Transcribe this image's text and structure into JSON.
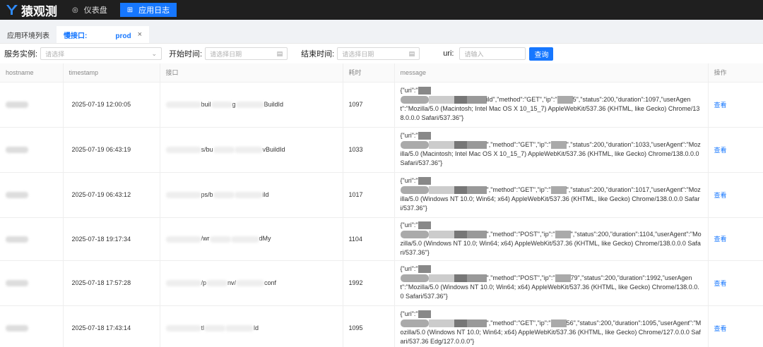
{
  "header": {
    "app_name": "猿观测",
    "nav": [
      {
        "label": "仪表盘",
        "icon": "dashboard-icon"
      },
      {
        "label": "应用日志",
        "icon": "log-grid-icon"
      }
    ]
  },
  "tabs": [
    {
      "label": "应用环境列表"
    },
    {
      "label": "慢接口:",
      "suffix": "prod"
    }
  ],
  "filters": {
    "instance_label": "服务实例:",
    "instance_placeholder": "请选择",
    "start_label": "开始时间:",
    "start_placeholder": "请选择日期",
    "end_label": "结束时间:",
    "end_placeholder": "请选择日期",
    "uri_label": "uri:",
    "uri_placeholder": "请输入",
    "search_label": "查询"
  },
  "table": {
    "columns": [
      "hostname",
      "timestamp",
      "接口",
      "耗时",
      "message",
      "操作"
    ],
    "rows": [
      {
        "timestamp": "2025-07-19 12:00:05",
        "api_parts": [
          "buil",
          "g",
          "BuildId"
        ],
        "duration": "1097",
        "msg_prefix": "{\"uri\":\"",
        "msg_mid": "ild\",\"method\":\"GET\",\"ip\":\"",
        "msg_rest": "5\",\"status\":200,\"duration\":1097,\"userAgent\":\"Mozilla/5.0 (Macintosh; Intel Mac OS X 10_15_7) AppleWebKit/537.36 (KHTML, like Gecko) Chrome/138.0.0.0 Safari/537.36\"}",
        "action": "查看"
      },
      {
        "timestamp": "2025-07-19 06:43:19",
        "api_parts": [
          "s/bu",
          "",
          "vBuildId"
        ],
        "duration": "1033",
        "msg_prefix": "{\"uri\":\"",
        "msg_mid": "\",\"method\":\"GET\",\"ip\":\"",
        "msg_rest": "\",\"status\":200,\"duration\":1033,\"userAgent\":\"Mozilla/5.0 (Macintosh; Intel Mac OS X 10_15_7) AppleWebKit/537.36 (KHTML, like Gecko) Chrome/138.0.0.0 Safari/537.36\"}",
        "action": "查看"
      },
      {
        "timestamp": "2025-07-19 06:43:12",
        "api_parts": [
          "ps/b",
          "",
          "ild"
        ],
        "duration": "1017",
        "msg_prefix": "{\"uri\":\"",
        "msg_mid": "\",\"method\":\"GET\",\"ip\":\"",
        "msg_rest": "\",\"status\":200,\"duration\":1017,\"userAgent\":\"Mozilla/5.0 (Windows NT 10.0; Win64; x64) AppleWebKit/537.36 (KHTML, like Gecko) Chrome/138.0.0.0 Safari/537.36\"}",
        "action": "查看"
      },
      {
        "timestamp": "2025-07-18 19:17:34",
        "api_parts": [
          "/wr",
          "",
          "dMy"
        ],
        "duration": "1104",
        "msg_prefix": "{\"uri\":\"",
        "msg_mid": "\",\"method\":\"POST\",\"ip\":\"",
        "msg_rest": "\",\"status\":200,\"duration\":1104,\"userAgent\":\"Mozilla/5.0 (Windows NT 10.0; Win64; x64) AppleWebKit/537.36 (KHTML, like Gecko) Chrome/138.0.0.0 Safari/537.36\"}",
        "action": "查看"
      },
      {
        "timestamp": "2025-07-18 17:57:28",
        "api_parts": [
          "/p",
          "nv/",
          "conf"
        ],
        "duration": "1992",
        "msg_prefix": "{\"uri\":\"",
        "msg_mid": "\",\"method\":\"POST\",\"ip\":\"",
        "msg_rest": "79\",\"status\":200,\"duration\":1992,\"userAgent\":\"Mozilla/5.0 (Windows NT 10.0; Win64; x64) AppleWebKit/537.36 (KHTML, like Gecko) Chrome/138.0.0.0 Safari/537.36\"}",
        "action": "查看"
      },
      {
        "timestamp": "2025-07-18 17:43:14",
        "api_parts": [
          "tl",
          "",
          "ld"
        ],
        "duration": "1095",
        "msg_prefix": "{\"uri\":\"",
        "msg_mid": "\",\"method\":\"GET\",\"ip\":\"",
        "msg_rest": "56\",\"status\":200,\"duration\":1095,\"userAgent\":\"Mozilla/5.0 (Windows NT 10.0; Win64; x64) AppleWebKit/537.36 (KHTML, like Gecko) Chrome/127.0.0.0 Safari/537.36 Edg/127.0.0.0\"}",
        "action": "查看"
      }
    ]
  },
  "colors": {
    "accent": "#1677ff",
    "topbar": "#1f1f1f"
  }
}
